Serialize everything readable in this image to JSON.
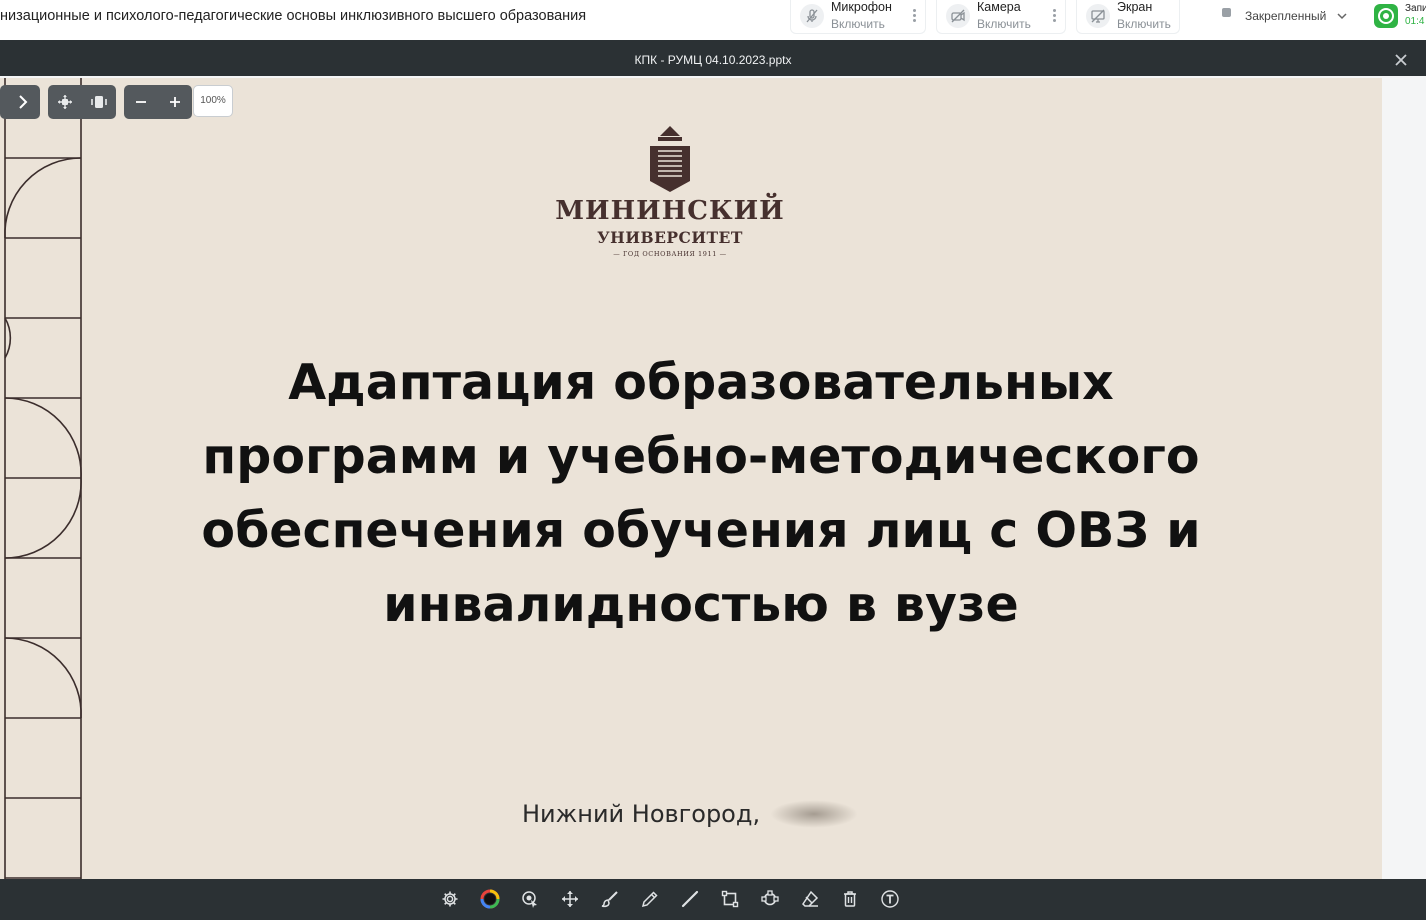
{
  "header": {
    "course_title": "низационные и психолого-педагогические основы инклюзивного высшего образования",
    "microphone": {
      "label": "Микрофон",
      "action": "Включить",
      "icon": "microphone-off-icon"
    },
    "camera": {
      "label": "Камера",
      "action": "Включить",
      "icon": "camera-off-icon"
    },
    "screen": {
      "label": "Экран",
      "action": "Включить",
      "icon": "screen-share-off-icon"
    },
    "layout_select": {
      "value": "Закрепленный"
    },
    "recording": {
      "label": "Запи",
      "time": "01:4"
    }
  },
  "viewer": {
    "file_name": "КПК - РУМЦ 04.10.2023.pptx",
    "zoom_level": "100%"
  },
  "slide": {
    "logo_name": "МИНИНСКИЙ",
    "logo_sub": "УНИВЕРСИТЕТ",
    "logo_year": "— ГОД ОСНОВАНИЯ 1911 —",
    "heading_lines": [
      "Адаптация образовательных",
      "программ и учебно-методического",
      "обеспечения обучения лиц с ОВЗ и",
      "инвалидностью в вузе"
    ],
    "footer": "Нижний Новгород,"
  },
  "colors": {
    "slide_bg": "#ebe3d8",
    "brand": "#46302e",
    "viewer_bg": "#2b3134",
    "recording": "#2fb344"
  },
  "toolbar": {
    "tools": [
      "settings-icon",
      "color-picker-icon",
      "laser-pointer-icon",
      "move-icon",
      "brush-icon",
      "pencil-icon",
      "line-icon",
      "rectangle-icon",
      "shape-icon",
      "eraser-icon",
      "trash-icon",
      "text-icon"
    ]
  }
}
